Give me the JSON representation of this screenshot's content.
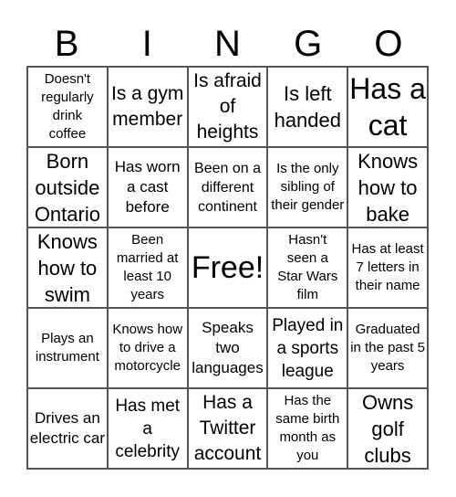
{
  "title_letters": [
    "B",
    "I",
    "N",
    "G",
    "O"
  ],
  "cells": [
    "Doesn't regularly drink coffee",
    "Is a gym member",
    "Is afraid of heights",
    "Is left handed",
    "Has a cat",
    "Born outside Ontario",
    "Has worn a cast before",
    "Been on a different continent",
    "Is the only sibling of their gender",
    "Knows how to bake",
    "Knows how to swim",
    "Been married at least 10 years",
    "Free!",
    "Hasn't seen a Star Wars film",
    "Has at least 7 letters in their name",
    "Plays an instrument",
    "Knows how to drive a motorcycle",
    "Speaks two languages",
    "Played in a sports league",
    "Graduated in the past 5 years",
    "Drives an electric car",
    "Has met a celebrity",
    "Has a Twitter account",
    "Has the same birth month as you",
    "Owns golf clubs"
  ]
}
